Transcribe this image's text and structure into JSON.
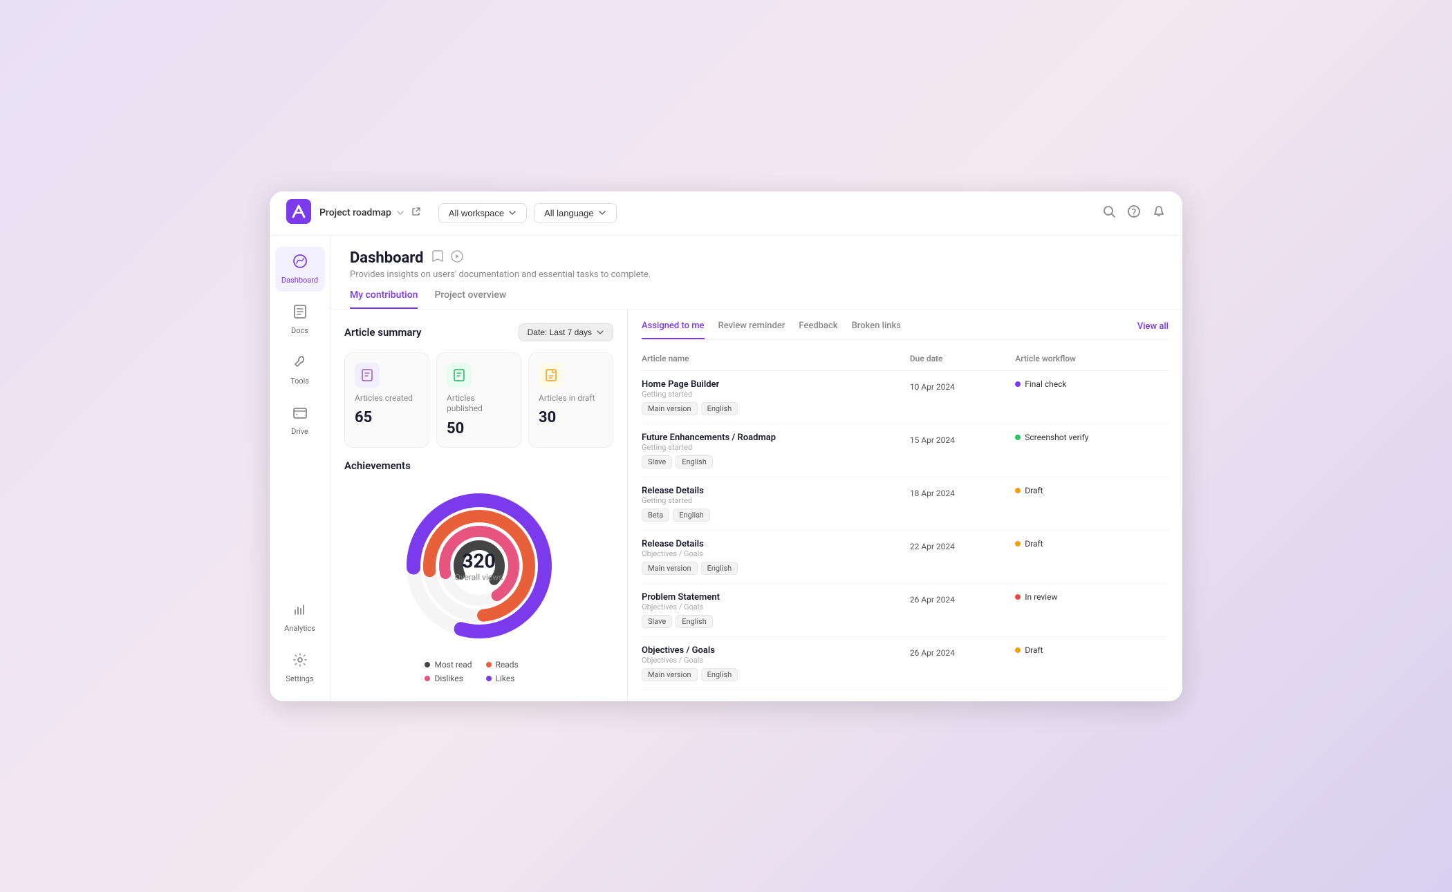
{
  "topbar": {
    "project_label": "Project roadmap",
    "workspace_filter": "All workspace",
    "language_filter": "All language"
  },
  "sidebar": {
    "items": [
      {
        "id": "dashboard",
        "label": "Dashboard",
        "icon": "🎨",
        "active": true
      },
      {
        "id": "docs",
        "label": "Docs",
        "icon": "📚",
        "active": false
      },
      {
        "id": "tools",
        "label": "Tools",
        "icon": "🔧",
        "active": false
      },
      {
        "id": "drive",
        "label": "Drive",
        "icon": "🗄️",
        "active": false
      },
      {
        "id": "analytics",
        "label": "Analytics",
        "icon": "📊",
        "active": false
      },
      {
        "id": "settings",
        "label": "Settings",
        "icon": "⚙️",
        "active": false
      }
    ]
  },
  "page": {
    "title": "Dashboard",
    "subtitle": "Provides insights on users' documentation and essential tasks to complete.",
    "tabs": [
      {
        "id": "my-contribution",
        "label": "My contribution",
        "active": true
      },
      {
        "id": "project-overview",
        "label": "Project overview",
        "active": false
      }
    ]
  },
  "article_summary": {
    "title": "Article summary",
    "date_filter": "Date:  Last 7 days",
    "stats": [
      {
        "id": "created",
        "label": "Articles created",
        "value": "65",
        "icon": "📄",
        "bg": "#f0eeff"
      },
      {
        "id": "published",
        "label": "Articles published",
        "value": "50",
        "icon": "📋",
        "bg": "#e8fdf0"
      },
      {
        "id": "draft",
        "label": "Articles in draft",
        "value": "30",
        "icon": "📝",
        "bg": "#fffbe8"
      }
    ]
  },
  "achievements": {
    "title": "Achievements",
    "overall_views": "320",
    "overall_label": "Overall views",
    "legend": [
      {
        "label": "Most read",
        "color": "#333"
      },
      {
        "label": "Reads",
        "color": "#f08080"
      },
      {
        "label": "Dislikes",
        "color": "#ff69b4"
      },
      {
        "label": "Likes",
        "color": "#7c3aed"
      }
    ]
  },
  "right_panel": {
    "tabs": [
      {
        "id": "assigned",
        "label": "Assigned to me",
        "active": true
      },
      {
        "id": "review",
        "label": "Review reminder",
        "active": false
      },
      {
        "id": "feedback",
        "label": "Feedback",
        "active": false
      },
      {
        "id": "broken",
        "label": "Broken links",
        "active": false
      }
    ],
    "view_all": "View all",
    "columns": [
      {
        "id": "name",
        "label": "Article name"
      },
      {
        "id": "due",
        "label": "Due date"
      },
      {
        "id": "workflow",
        "label": "Article workflow"
      }
    ],
    "articles": [
      {
        "name": "Home Page Builder",
        "section": "Getting started",
        "tags": [
          "Main version",
          "English"
        ],
        "due_date": "10 Apr 2024",
        "workflow": "Final check",
        "workflow_color": "#7c3aed"
      },
      {
        "name": "Future Enhancements / Roadmap",
        "section": "Getting started",
        "tags": [
          "Slave",
          "English"
        ],
        "due_date": "15 Apr 2024",
        "workflow": "Screenshot verify",
        "workflow_color": "#22c55e"
      },
      {
        "name": "Release Details",
        "section": "Getting started",
        "tags": [
          "Beta",
          "English"
        ],
        "due_date": "18 Apr 2024",
        "workflow": "Draft",
        "workflow_color": "#f59e0b"
      },
      {
        "name": "Release Details",
        "section": "Objectives / Goals",
        "tags": [
          "Main version",
          "English"
        ],
        "due_date": "22 Apr 2024",
        "workflow": "Draft",
        "workflow_color": "#f59e0b"
      },
      {
        "name": "Problem Statement",
        "section": "Objectives / Goals",
        "tags": [
          "Slave",
          "English"
        ],
        "due_date": "26 Apr 2024",
        "workflow": "In review",
        "workflow_color": "#ef4444"
      },
      {
        "name": "Objectives / Goals",
        "section": "Objectives / Goals",
        "tags": [
          "Main version",
          "English"
        ],
        "due_date": "26 Apr 2024",
        "workflow": "Draft",
        "workflow_color": "#f59e0b"
      }
    ]
  }
}
